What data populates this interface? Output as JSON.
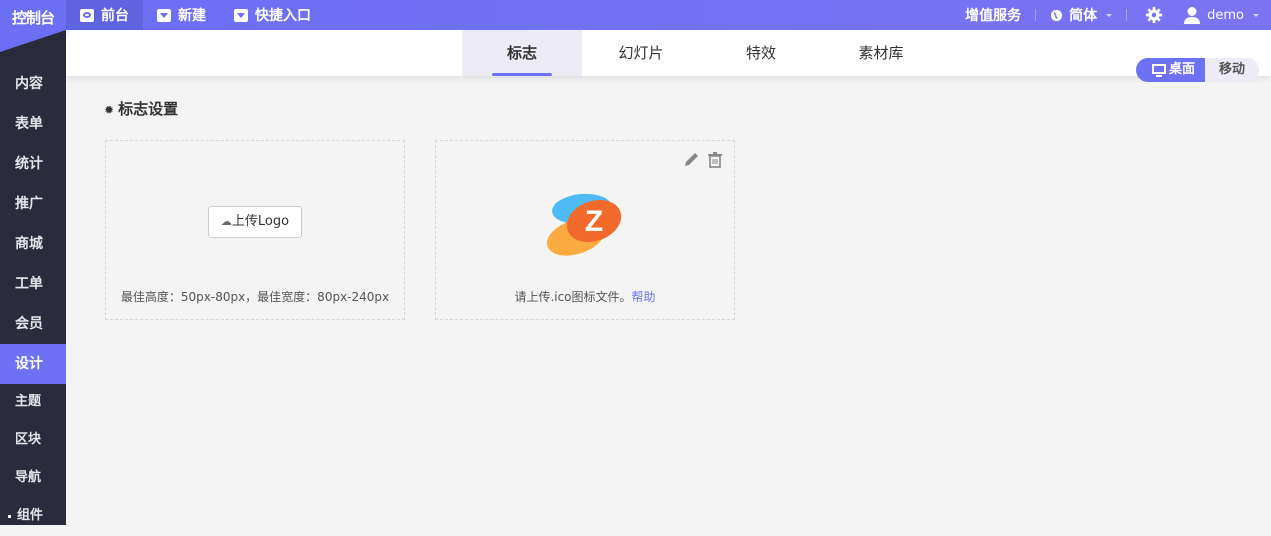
{
  "brand": "控制台",
  "topnav": [
    {
      "label": "前台",
      "icon": "eye-icon"
    },
    {
      "label": "新建",
      "icon": "dropdown-icon"
    },
    {
      "label": "快捷入口",
      "icon": "dropdown-icon"
    }
  ],
  "topright": {
    "vas": "增值服务",
    "lang": "简体",
    "user": "demo"
  },
  "sidebar": [
    "内容",
    "表单",
    "统计",
    "推广",
    "商城",
    "工单",
    "会员",
    "设计",
    "主题",
    "区块",
    "导航",
    "组件"
  ],
  "tabs": [
    "标志",
    "幻灯片",
    "特效",
    "素材库"
  ],
  "device": {
    "desktop": "桌面",
    "mobile": "移动"
  },
  "section_title": "标志设置",
  "logo_card": {
    "button": "上传Logo",
    "hint": "最佳高度：50px-80px，最佳宽度：80px-240px"
  },
  "ico_card": {
    "hint": "请上传.ico图标文件。",
    "help": "帮助",
    "logo_letter": "Z"
  },
  "colors": {
    "accent": "#6d71f4",
    "sidebar": "#2a2c3b"
  }
}
